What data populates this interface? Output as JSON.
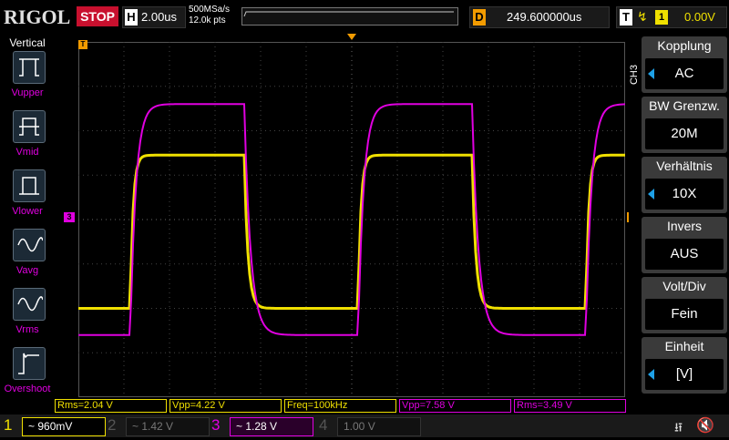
{
  "header": {
    "brand": "RIGOL",
    "run_state": "STOP",
    "timebase_letter": "H",
    "timebase": "2.00us",
    "sample_rate": "500MSa/s",
    "memory_depth": "12.0k pts",
    "delay_letter": "D",
    "delay": "249.600000us",
    "trigger_letter": "T",
    "trigger_slope": "↯",
    "trigger_source": "1",
    "trigger_level": "0.00V"
  },
  "left_menu": {
    "title": "Vertical",
    "items": [
      {
        "label": "Vupper",
        "icon": "vupper-icon"
      },
      {
        "label": "Vmid",
        "icon": "vmid-icon"
      },
      {
        "label": "Vlower",
        "icon": "vlower-icon"
      },
      {
        "label": "Vavg",
        "icon": "vavg-icon"
      },
      {
        "label": "Vrms",
        "icon": "vrms-icon"
      },
      {
        "label": "Overshoot",
        "icon": "overshoot-icon"
      }
    ]
  },
  "grid_markers": {
    "trigger_top": "T",
    "ch3_marker": "3",
    "trigger_level_marker": "T"
  },
  "right_menu": {
    "channel_tag": "CH3",
    "groups": [
      {
        "title": "Kopplung",
        "value": "AC",
        "has_arrow": true
      },
      {
        "title": "BW Grenzw.",
        "value": "20M",
        "has_arrow": false
      },
      {
        "title": "Verhältnis",
        "value": "10X",
        "has_arrow": true
      },
      {
        "title": "Invers",
        "value": "AUS",
        "has_arrow": false
      },
      {
        "title": "Volt/Div",
        "value": "Fein",
        "has_arrow": false
      },
      {
        "title": "Einheit",
        "value": "[V]",
        "has_arrow": true
      }
    ]
  },
  "measurements": [
    {
      "text": "Rms=2.04 V",
      "color": "#f0e000"
    },
    {
      "text": "Vpp=4.22 V",
      "color": "#f0e000"
    },
    {
      "text": "Freq=100kHz",
      "color": "#f0e000"
    },
    {
      "text": "Vpp=7.58 V",
      "color": "#e000e0"
    },
    {
      "text": "Rms=3.49 V",
      "color": "#e000e0"
    }
  ],
  "channels": [
    {
      "num": "1",
      "value": "~ 960mV",
      "color": "#f0e000",
      "active": true
    },
    {
      "num": "2",
      "value": "~ 1.42 V",
      "color": "#2fa0a0",
      "active": false
    },
    {
      "num": "3",
      "value": "~ 1.28 V",
      "color": "#e000e0",
      "active": true
    },
    {
      "num": "4",
      "value": "1.00 V",
      "color": "#4060c0",
      "active": false
    }
  ],
  "status_icons": [
    "usb-icon",
    "speaker-muted-icon"
  ],
  "colors": {
    "ch1": "#f0e000",
    "ch3": "#e000e0",
    "accent": "#1ea0e6",
    "stop": "#c8102e",
    "delay": "#f29b00"
  },
  "waveforms": {
    "period_div": 5,
    "ch1": {
      "low_level_div": -2.0,
      "high_level_div": 1.45
    },
    "ch3": {
      "low_level_div": -2.6,
      "high_level_div": 2.6
    }
  }
}
